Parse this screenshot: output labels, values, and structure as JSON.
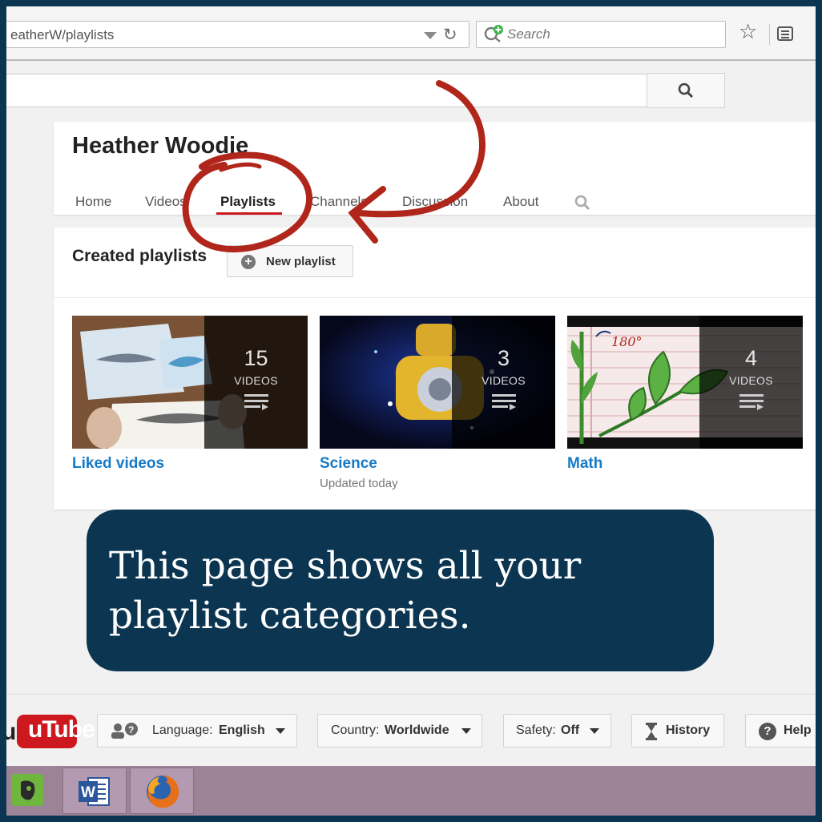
{
  "browser": {
    "url": "eatherW/playlists",
    "search_placeholder": "Search"
  },
  "channel": {
    "name": "Heather Woodie",
    "tabs": [
      {
        "label": "Home"
      },
      {
        "label": "Videos"
      },
      {
        "label": "Playlists",
        "active": true
      },
      {
        "label": "Channels"
      },
      {
        "label": "Discussion"
      },
      {
        "label": "About"
      }
    ]
  },
  "section": {
    "title": "Created playlists",
    "new_playlist_label": "New playlist"
  },
  "playlists": [
    {
      "title": "Liked videos",
      "count": "15",
      "count_label": "VIDEOS",
      "subtitle": ""
    },
    {
      "title": "Science",
      "count": "3",
      "count_label": "VIDEOS",
      "subtitle": "Updated today"
    },
    {
      "title": "Math",
      "count": "4",
      "count_label": "VIDEOS",
      "subtitle": ""
    }
  ],
  "callout": {
    "text": "This page shows all your playlist categories."
  },
  "footer": {
    "logo_text": "uTube",
    "language_label": "Language:",
    "language_value": "English",
    "country_label": "Country:",
    "country_value": "Worldwide",
    "safety_label": "Safety:",
    "safety_value": "Off",
    "history_label": "History",
    "help_label": "Help"
  },
  "colors": {
    "accent_red": "#cc181e",
    "link_blue": "#167ac6",
    "callout_bg": "#0b3550",
    "annotation_red": "#b0261a",
    "taskbar": "#9c8396"
  },
  "icons": {
    "reload": "reload-icon",
    "search_engine": "search-engine-icon",
    "bookmark": "star-icon",
    "reader": "reader-icon",
    "search": "search-icon",
    "playlist": "playlist-icon",
    "add": "plus-icon",
    "language": "language-icon",
    "history": "hourglass-icon",
    "help": "help-icon",
    "taskbar": [
      "evernote-icon",
      "word-icon",
      "firefox-icon"
    ]
  }
}
